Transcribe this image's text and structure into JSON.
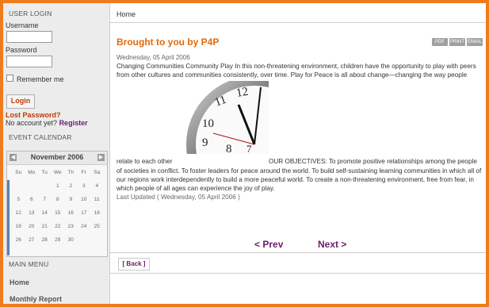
{
  "sidebar": {
    "login_title": "USER LOGIN",
    "username_label": "Username",
    "password_label": "Password",
    "remember_label": "Remember me",
    "login_button": "Login",
    "lost_password": "Lost Password?",
    "no_account_text": "No account yet?",
    "register_link": "Register",
    "event_calendar_title": "EVENT CALENDAR",
    "calendar": {
      "month": "November 2006",
      "weekdays": [
        "Su",
        "Mo",
        "Tu",
        "We",
        "Th",
        "Fr",
        "Sa"
      ],
      "weeks": [
        [
          "",
          "",
          "",
          "1",
          "2",
          "3",
          "4"
        ],
        [
          "5",
          "6",
          "7",
          "8",
          "9",
          "10",
          "11"
        ],
        [
          "12",
          "13",
          "14",
          "15",
          "16",
          "17",
          "18"
        ],
        [
          "19",
          "20",
          "21",
          "22",
          "23",
          "24",
          "25"
        ],
        [
          "26",
          "27",
          "28",
          "29",
          "30",
          "",
          ""
        ]
      ]
    },
    "main_menu_title": "MAIN MENU",
    "menu_items": [
      "Home",
      "Monthly Report"
    ]
  },
  "main": {
    "breadcrumb": "Home",
    "article_title": "Brought to you by P4P",
    "icons": [
      "PDF",
      "PRINT",
      "EMAIL"
    ],
    "date": "Wednesday, 05 April 2006",
    "paragraph1": "Changing Communities Community Play In this non-threatening environment, children have the opportunity to play with peers from other cultures and communities consistently, over time. Play for Peace is all about change—changing the way people",
    "relate_text": "relate to each other",
    "objectives_start": "OUR OBJECTIVES: To promote positive relationships among the people",
    "paragraph2": "of societies in conflict. To foster leaders for peace around the world. To build self-sustaining learning communities in which all of our regions work interdependently to build a more peaceful world. To create a non-threatening environment, free from fear, in which people of all ages can experience the joy of play.",
    "last_updated": "Last Updated ( Wednesday, 05 April 2006 )",
    "prev_label": "< Prev",
    "next_label": "Next >",
    "back_label": "[ Back ]"
  },
  "colors": {
    "frame_orange": "#f07b1c",
    "title_orange": "#e06a0c",
    "link_purple": "#6a1b6a"
  }
}
